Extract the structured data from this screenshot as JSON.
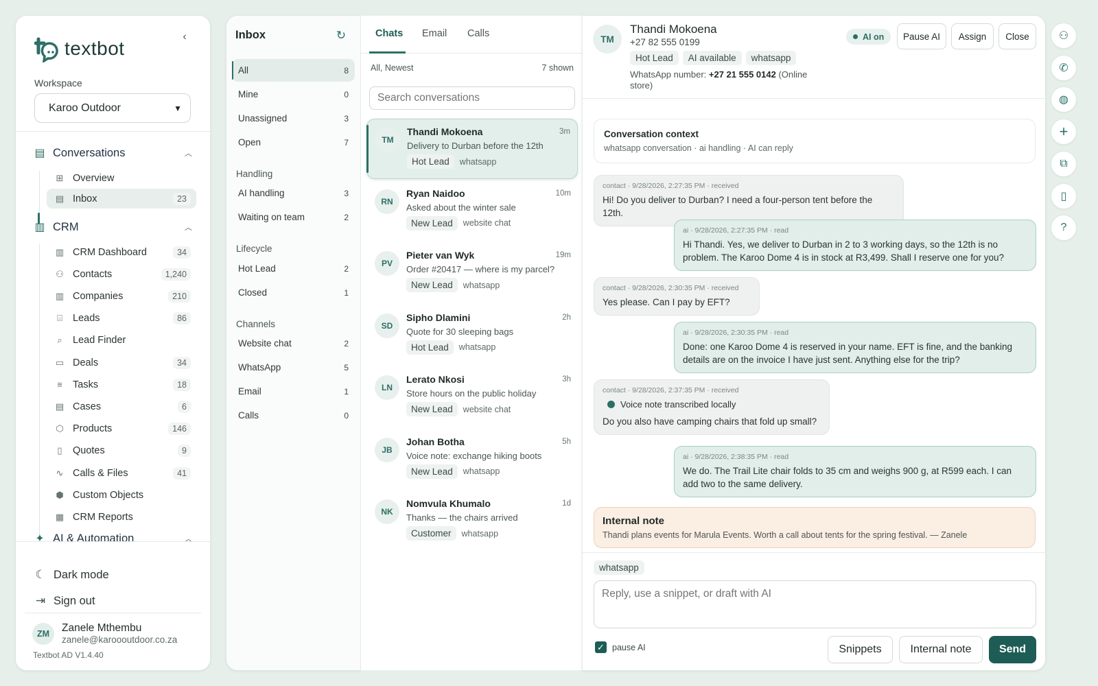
{
  "brand": {
    "name": "textbot"
  },
  "workspace": {
    "label": "Workspace",
    "selected": "Karoo Outdoor"
  },
  "sidebar": {
    "conversations": {
      "label": "Conversations",
      "items": [
        {
          "label": "Overview",
          "icon": "grid-icon"
        },
        {
          "label": "Inbox",
          "count": "23",
          "icon": "inbox-icon"
        }
      ]
    },
    "crm": {
      "label": "CRM",
      "items": [
        {
          "label": "CRM Dashboard",
          "count": "34",
          "icon": "building-icon"
        },
        {
          "label": "Contacts",
          "count": "1,240",
          "icon": "person-icon"
        },
        {
          "label": "Companies",
          "count": "210",
          "icon": "building-icon"
        },
        {
          "label": "Leads",
          "count": "86",
          "icon": "lead-icon"
        },
        {
          "label": "Lead Finder",
          "count": "",
          "icon": "search-icon"
        },
        {
          "label": "Deals",
          "count": "34",
          "icon": "briefcase-icon"
        },
        {
          "label": "Tasks",
          "count": "18",
          "icon": "checklist-icon"
        },
        {
          "label": "Cases",
          "count": "6",
          "icon": "case-icon"
        },
        {
          "label": "Products",
          "count": "146",
          "icon": "box-icon"
        },
        {
          "label": "Quotes",
          "count": "9",
          "icon": "document-icon"
        },
        {
          "label": "Calls & Files",
          "count": "41",
          "icon": "activity-icon"
        },
        {
          "label": "Custom Objects",
          "count": "",
          "icon": "cube-icon"
        },
        {
          "label": "CRM Reports",
          "count": "",
          "icon": "chart-icon"
        }
      ]
    },
    "ai_section": {
      "label": "AI & Automation"
    },
    "dark_mode": "Dark mode",
    "sign_out": "Sign out",
    "user": {
      "initials": "ZM",
      "name": "Zanele Mthembu",
      "email": "zanele@karoooutdoor.co.za"
    },
    "version": "Textbot AD V1.4.40"
  },
  "inbox": {
    "title": "Inbox",
    "filters": [
      {
        "label": "All",
        "count": "8"
      },
      {
        "label": "Mine",
        "count": "0"
      },
      {
        "label": "Unassigned",
        "count": "3"
      },
      {
        "label": "Open",
        "count": "7"
      }
    ],
    "handling": {
      "label": "Handling",
      "items": [
        {
          "label": "AI handling",
          "count": "3"
        },
        {
          "label": "Waiting on team",
          "count": "2"
        }
      ]
    },
    "lifecycle": {
      "label": "Lifecycle",
      "items": [
        {
          "label": "Hot Lead",
          "count": "2"
        },
        {
          "label": "Closed",
          "count": "1"
        }
      ]
    },
    "channels": {
      "label": "Channels",
      "items": [
        {
          "label": "Website chat",
          "count": "2"
        },
        {
          "label": "WhatsApp",
          "count": "5"
        },
        {
          "label": "Email",
          "count": "1"
        },
        {
          "label": "Calls",
          "count": "0"
        }
      ]
    }
  },
  "list": {
    "tabs": [
      "Chats",
      "Email",
      "Calls"
    ],
    "sort": "All, Newest",
    "shown": "7 shown",
    "search_placeholder": "Search conversations",
    "conversations": [
      {
        "initials": "TM",
        "name": "Thandi Mokoena",
        "time": "3m",
        "preview": "Delivery to Durban before the 12th",
        "tag": "Hot Lead",
        "channel": "whatsapp"
      },
      {
        "initials": "RN",
        "name": "Ryan Naidoo",
        "time": "10m",
        "preview": "Asked about the winter sale",
        "tag": "New Lead",
        "channel": "website chat"
      },
      {
        "initials": "PV",
        "name": "Pieter van Wyk",
        "time": "19m",
        "preview": "Order #20417 — where is my parcel?",
        "tag": "New Lead",
        "channel": "whatsapp"
      },
      {
        "initials": "SD",
        "name": "Sipho Dlamini",
        "time": "2h",
        "preview": "Quote for 30 sleeping bags",
        "tag": "Hot Lead",
        "channel": "whatsapp"
      },
      {
        "initials": "LN",
        "name": "Lerato Nkosi",
        "time": "3h",
        "preview": "Store hours on the public holiday",
        "tag": "New Lead",
        "channel": "website chat"
      },
      {
        "initials": "JB",
        "name": "Johan Botha",
        "time": "5h",
        "preview": "Voice note: exchange hiking boots",
        "tag": "New Lead",
        "channel": "whatsapp"
      },
      {
        "initials": "NK",
        "name": "Nomvula Khumalo",
        "time": "1d",
        "preview": "Thanks — the chairs arrived",
        "tag": "Customer",
        "channel": "whatsapp"
      }
    ]
  },
  "chat": {
    "contact": {
      "initials": "TM",
      "name": "Thandi Mokoena",
      "phone": "+27 82 555 0199",
      "tags": [
        "Hot Lead",
        "AI available",
        "whatsapp"
      ],
      "wa_label": "WhatsApp number: ",
      "wa_number": "+27 21 555 0142",
      "wa_suffix": " (Online store)"
    },
    "ai_status": "AI on",
    "buttons": {
      "pause": "Pause AI",
      "assign": "Assign",
      "close": "Close"
    },
    "context": {
      "title": "Conversation context",
      "subtitle": "whatsapp conversation · ai handling · AI can reply"
    },
    "messages": [
      {
        "meta": "contact · 9/28/2026, 2:27:35 PM · received",
        "text": "Hi! Do you deliver to Durban? I need a four-person tent before the 12th."
      },
      {
        "meta": "ai · 9/28/2026, 2:27:35 PM · read",
        "text": "Hi Thandi. Yes, we deliver to Durban in 2 to 3 working days, so the 12th is no problem. The Karoo Dome 4 is in stock at R3,499. Shall I reserve one for you?"
      },
      {
        "meta": "contact · 9/28/2026, 2:30:35 PM · received",
        "text": "Yes please. Can I pay by EFT?"
      },
      {
        "meta": "ai · 9/28/2026, 2:30:35 PM · read",
        "text": "Done: one Karoo Dome 4 is reserved in your name. EFT is fine, and the banking details are on the invoice I have just sent. Anything else for the trip?"
      },
      {
        "meta": "contact · 9/28/2026, 2:37:35 PM · received",
        "voice": "Voice note transcribed locally",
        "text": "Do you also have camping chairs that fold up small?"
      },
      {
        "meta": "ai · 9/28/2026, 2:38:35 PM · read",
        "text": "We do. The Trail Lite chair folds to 35 cm and weighs 900 g, at R599 each. I can add two to the same delivery."
      }
    ],
    "note": {
      "title": "Internal note",
      "text": "Thandi plans events for Marula Events. Worth a call about tents for the spring festival. — Zanele"
    },
    "composer": {
      "channel": "whatsapp",
      "placeholder": "Reply, use a snippet, or draft with AI",
      "pause_label": "pause AI",
      "snippets": "Snippets",
      "internal_note": "Internal note",
      "send": "Send"
    }
  },
  "rail": [
    "user-icon",
    "phone-icon",
    "brain-icon",
    "plus-icon",
    "merge-icon",
    "clipboard-icon",
    "help-icon"
  ]
}
